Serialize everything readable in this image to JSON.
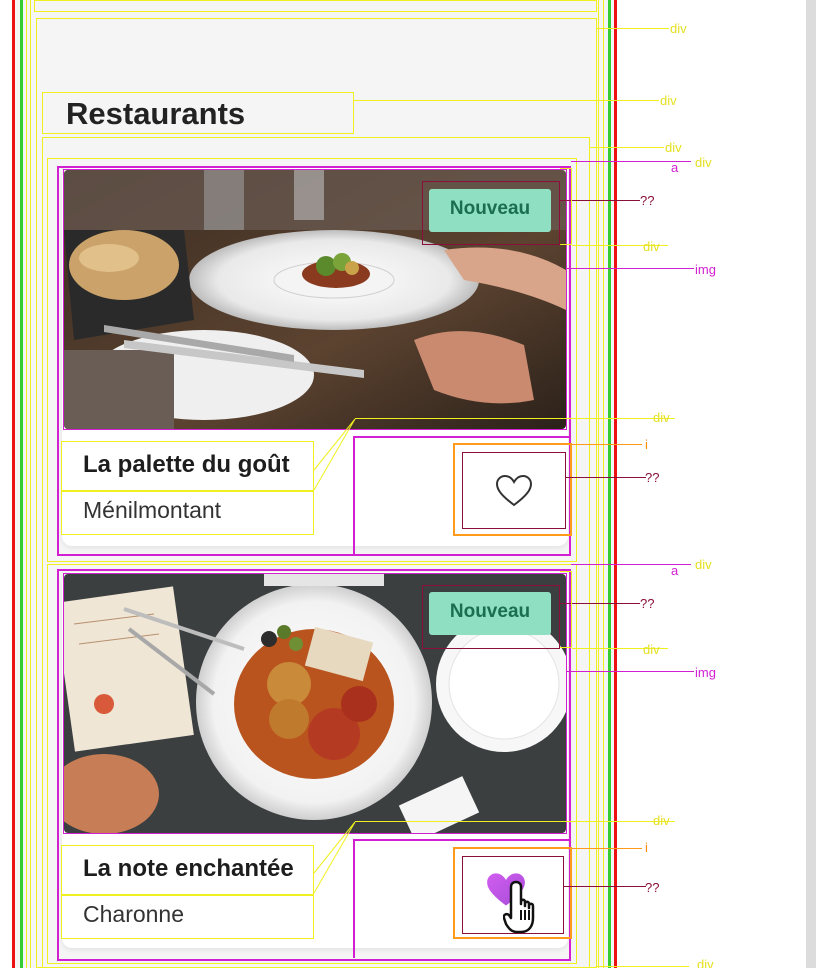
{
  "section": {
    "title": "Restaurants"
  },
  "cards": [
    {
      "badge": "Nouveau",
      "name": "La palette du goût",
      "location": "Ménilmontant",
      "favorited": false,
      "heart_icon": "heart-outline-icon"
    },
    {
      "badge": "Nouveau",
      "name": "La note enchantée",
      "location": "Charonne",
      "favorited": true,
      "heart_icon": "heart-filled-icon",
      "cursor_icon": "hand-pointer-icon"
    }
  ],
  "inspector_labels": {
    "div": "div",
    "a": "a",
    "img": "img",
    "i": "i",
    "unknown": "??"
  },
  "colors": {
    "badge_bg": "#8fe0c3",
    "badge_text": "#1b6e52",
    "heart_filled": "#c45cf2",
    "overlay_div": "#f0f020",
    "overlay_link": "#d21fd2",
    "overlay_icon": "#ff9a1a",
    "overlay_unknown": "#8a0f3a"
  }
}
